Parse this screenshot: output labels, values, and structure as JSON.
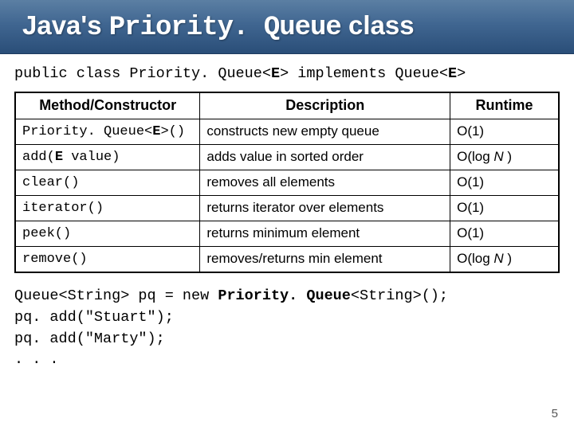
{
  "title": {
    "prefix": "Java's ",
    "mono": "Priority. Queue",
    "suffix": " class"
  },
  "signature": {
    "pre": "public class Priority. Queue<",
    "gen1": "E",
    "mid": "> implements Queue<",
    "gen2": "E",
    "post": ">"
  },
  "headers": {
    "method": "Method/Constructor",
    "desc": "Description",
    "rt": "Runtime"
  },
  "rows": [
    {
      "m_pre": "Priority. Queue<",
      "m_bold": "E",
      "m_post": ">()",
      "desc": "constructs new empty queue",
      "rt_pre": "O(1)",
      "rt_var": "",
      "rt_post": ""
    },
    {
      "m_pre": "add(",
      "m_bold": "E",
      "m_post": " value)",
      "desc": "adds value in sorted order",
      "rt_pre": "O(log ",
      "rt_var": "N",
      "rt_post": " )"
    },
    {
      "m_pre": "clear()",
      "m_bold": "",
      "m_post": "",
      "desc": "removes all elements",
      "rt_pre": "O(1)",
      "rt_var": "",
      "rt_post": ""
    },
    {
      "m_pre": "iterator()",
      "m_bold": "",
      "m_post": "",
      "desc": "returns iterator over elements",
      "rt_pre": "O(1)",
      "rt_var": "",
      "rt_post": ""
    },
    {
      "m_pre": "peek()",
      "m_bold": "",
      "m_post": "",
      "desc": "returns minimum element",
      "rt_pre": "O(1)",
      "rt_var": "",
      "rt_post": ""
    },
    {
      "m_pre": "remove()",
      "m_bold": "",
      "m_post": "",
      "desc": "removes/returns min element",
      "rt_pre": "O(log ",
      "rt_var": "N",
      "rt_post": " )"
    }
  ],
  "code": {
    "l1a": "Queue<String> pq = new ",
    "l1b": "Priority. Queue",
    "l1c": "<String>();",
    "l2": "pq. add(\"Stuart\");",
    "l3": "pq. add(\"Marty\");",
    "l4": ". . ."
  },
  "page": "5",
  "chart_data": {
    "type": "table",
    "title": "Java's PriorityQueue class — method summary",
    "columns": [
      "Method/Constructor",
      "Description",
      "Runtime"
    ],
    "rows": [
      [
        "Priority.Queue<E>()",
        "constructs new empty queue",
        "O(1)"
      ],
      [
        "add(E value)",
        "adds value in sorted order",
        "O(log N)"
      ],
      [
        "clear()",
        "removes all elements",
        "O(1)"
      ],
      [
        "iterator()",
        "returns iterator over elements",
        "O(1)"
      ],
      [
        "peek()",
        "returns minimum element",
        "O(1)"
      ],
      [
        "remove()",
        "removes/returns min element",
        "O(log N)"
      ]
    ]
  }
}
